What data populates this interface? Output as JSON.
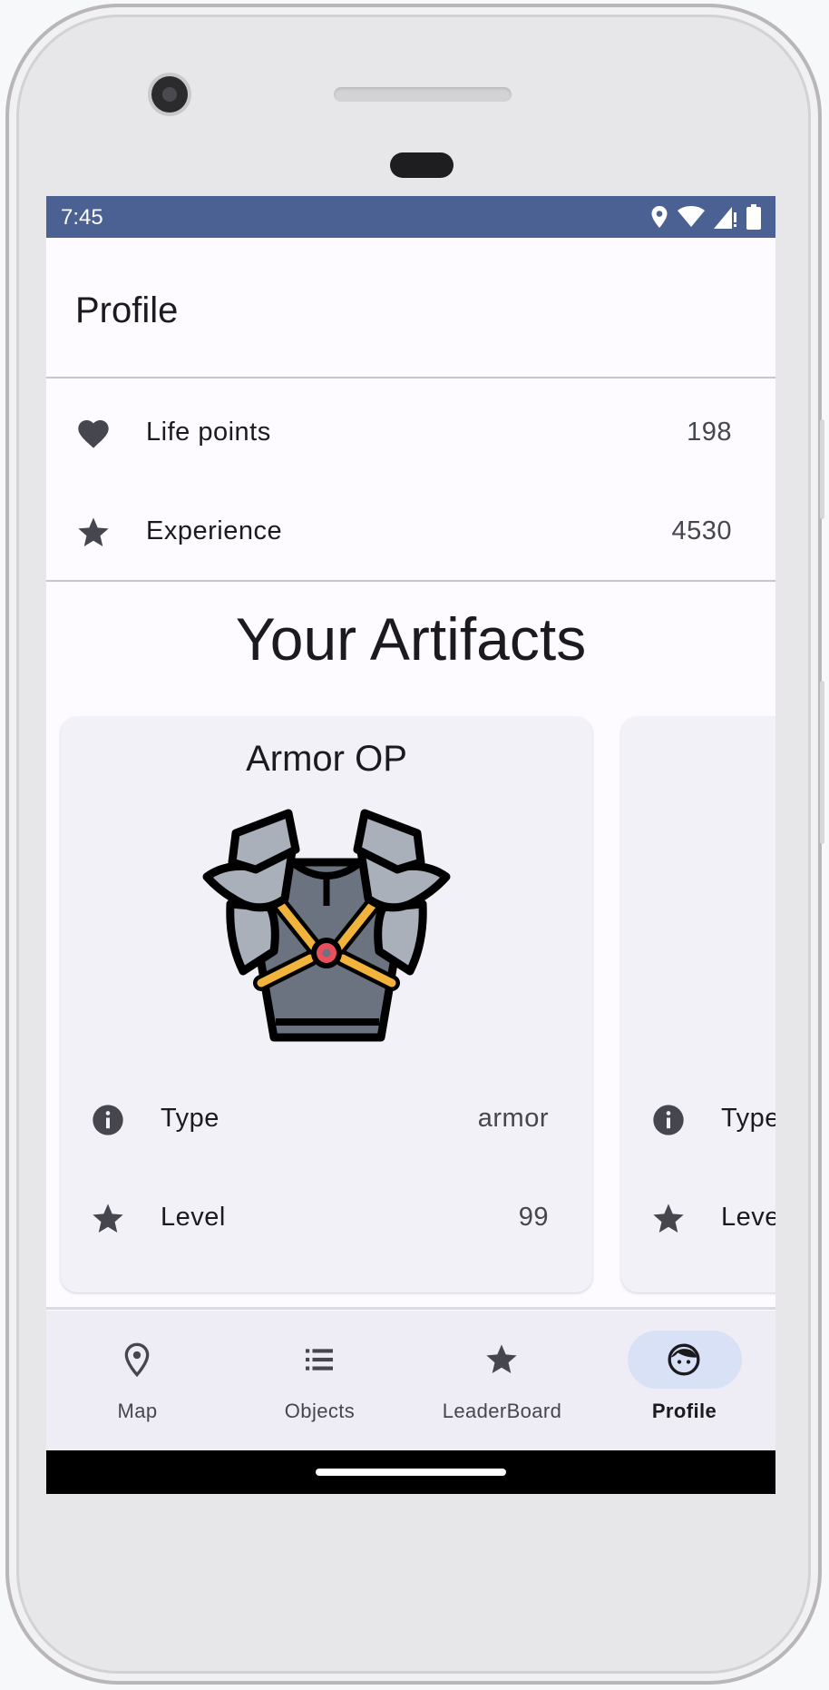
{
  "status_bar": {
    "time": "7:45"
  },
  "app_bar": {
    "title": "Profile"
  },
  "stats": [
    {
      "icon": "heart-icon",
      "label": "Life points",
      "value": "198"
    },
    {
      "icon": "star-icon",
      "label": "Experience",
      "value": "4530"
    }
  ],
  "artifacts": {
    "title": "Your Artifacts",
    "cards": [
      {
        "name": "Armor OP",
        "image": "armor-icon",
        "rows": [
          {
            "icon": "info-icon",
            "label": "Type",
            "value": "armor"
          },
          {
            "icon": "star-icon",
            "label": "Level",
            "value": "99"
          }
        ]
      },
      {
        "name": "",
        "rows": [
          {
            "icon": "info-icon",
            "label": "Type",
            "value": ""
          },
          {
            "icon": "star-icon",
            "label": "Level",
            "value": ""
          }
        ]
      }
    ]
  },
  "nav": [
    {
      "icon": "map-pin-icon",
      "label": "Map",
      "active": false
    },
    {
      "icon": "list-icon",
      "label": "Objects",
      "active": false
    },
    {
      "icon": "star-icon",
      "label": "LeaderBoard",
      "active": false
    },
    {
      "icon": "face-icon",
      "label": "Profile",
      "active": true
    }
  ],
  "colors": {
    "status_bar": "#4b6194",
    "background": "#fdfbff",
    "card": "#f3f1f8",
    "nav_bar": "#eeecf5",
    "nav_active_pill": "#d9e1f7",
    "icon": "#46464f"
  }
}
